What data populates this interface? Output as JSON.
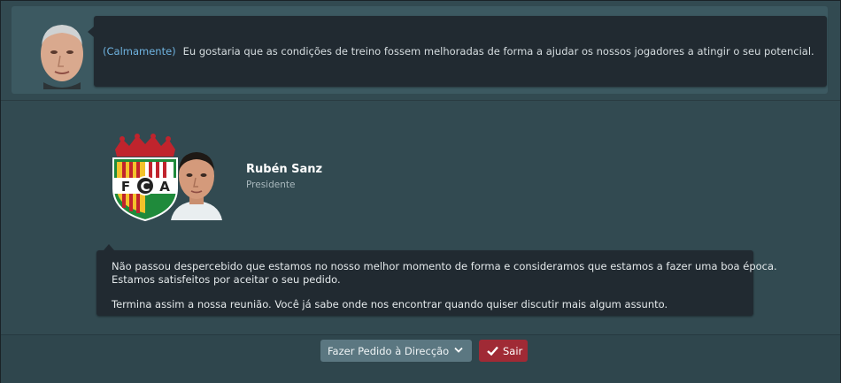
{
  "manager": {
    "tone": "(Calmamente)",
    "statement": "Eu gostaria que as condições de treino fossem melhoradas de forma a ajudar os nossos jogadores a atingir o seu potencial."
  },
  "chairman": {
    "name": "Rubén Sanz",
    "role": "Presidente",
    "crest_letters": [
      "F",
      "C",
      "A"
    ]
  },
  "response": {
    "line1": "Não passou despercebido que estamos no nosso melhor momento de forma e consideramos que estamos a fazer uma boa época.",
    "line2": "Estamos satisfeitos por aceitar o seu pedido.",
    "line3": "Termina assim a nossa reunião. Você já sabe onde nos encontrar quando quiser discutir mais algum assunto."
  },
  "actions": {
    "request_label": "Fazer Pedido à Direcção",
    "exit_label": "Sair"
  },
  "colors": {
    "tone": "#6fb3e0",
    "exit_button": "#a02a35",
    "select_button": "#5b7781"
  },
  "icons": [
    "manager-avatar",
    "club-crest",
    "chairman-avatar",
    "chevron-down-icon",
    "check-icon"
  ]
}
